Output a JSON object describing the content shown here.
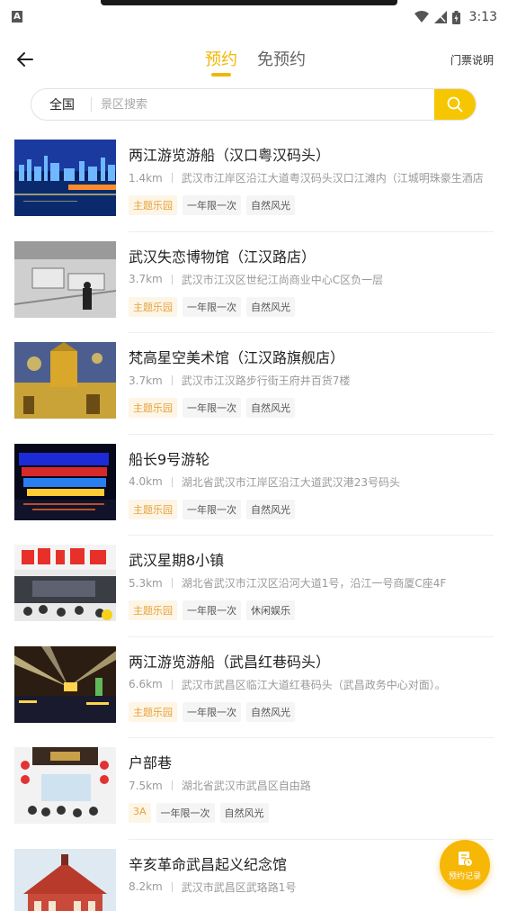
{
  "status": {
    "time": "3:13",
    "left_glyph": "A"
  },
  "header": {
    "tabs": [
      {
        "label": "预约",
        "active": true
      },
      {
        "label": "免预约",
        "active": false
      }
    ],
    "right_link": "门票说明"
  },
  "search": {
    "region": "全国",
    "placeholder": "景区搜索"
  },
  "items": [
    {
      "title": "两江游览游船（汉口粤汉码头）",
      "distance": "1.4km",
      "address": "武汉市江岸区沿江大道粤汉码头汉口江滩内（江城明珠豪生酒店",
      "tags": [
        "主题乐园",
        "一年限一次",
        "自然风光"
      ],
      "thumb": "night-river"
    },
    {
      "title": "武汉失恋博物馆（江汉路店）",
      "distance": "3.7km",
      "address": "武汉市江汉区世纪江尚商业中心C区负一层",
      "tags": [
        "主题乐园",
        "一年限一次",
        "自然风光"
      ],
      "thumb": "gallery"
    },
    {
      "title": "梵高星空美术馆（江汉路旗舰店）",
      "distance": "3.7km",
      "address": "武汉市江汉路步行街王府井百货7楼",
      "tags": [
        "主题乐园",
        "一年限一次",
        "自然风光"
      ],
      "thumb": "vangogh"
    },
    {
      "title": "船长9号游轮",
      "distance": "4.0km",
      "address": "湖北省武汉市江岸区沿江大道武汉港23号码头",
      "tags": [
        "主题乐园",
        "一年限一次",
        "自然风光"
      ],
      "thumb": "cruise"
    },
    {
      "title": "武汉星期8小镇",
      "distance": "5.3km",
      "address": "湖北省武汉市江汉区沿河大道1号，沿江一号商厦C座4F",
      "tags": [
        "主题乐园",
        "一年限一次",
        "休闲娱乐"
      ],
      "thumb": "town"
    },
    {
      "title": "两江游览游船（武昌红巷码头）",
      "distance": "6.6km",
      "address": "武汉市武昌区临江大道红巷码头（武昌政务中心对面）。",
      "tags": [
        "主题乐园",
        "一年限一次",
        "自然风光"
      ],
      "thumb": "lights"
    },
    {
      "title": "户部巷",
      "distance": "7.5km",
      "address": "湖北省武汉市武昌区自由路",
      "tags": [
        "3A",
        "一年限一次",
        "自然风光"
      ],
      "thumb": "alley"
    },
    {
      "title": "辛亥革命武昌起义纪念馆",
      "distance": "8.2km",
      "address": "武汉市武昌区武珞路1号",
      "tags": [],
      "thumb": "memorial"
    }
  ],
  "fab": {
    "label": "预约记录"
  },
  "colors": {
    "accent": "#f2b705",
    "tag_highlight": "#e6a23c"
  }
}
